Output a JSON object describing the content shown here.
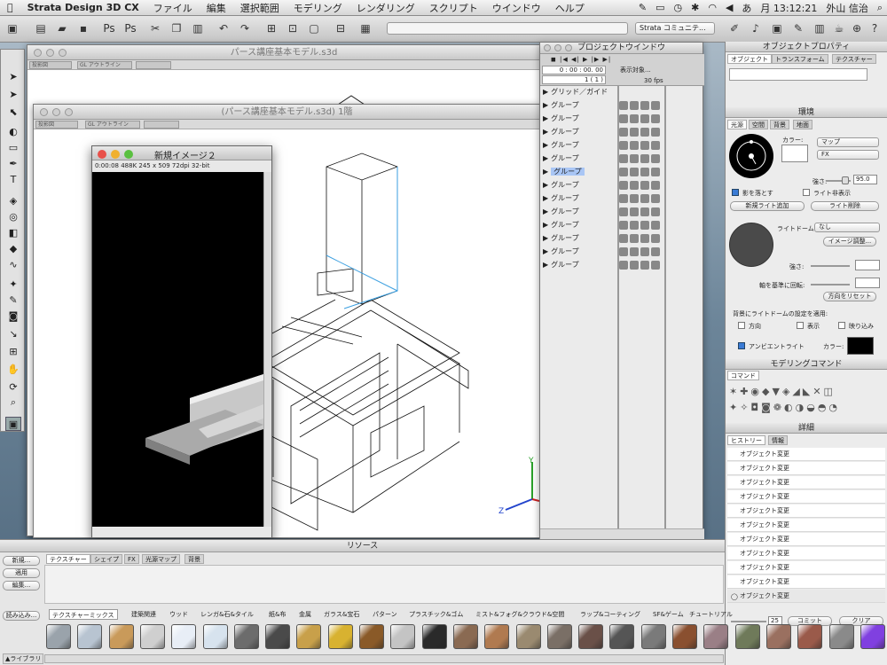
{
  "menubar": {
    "app": "Strata Design 3D CX",
    "items": [
      "ファイル",
      "編集",
      "選択範囲",
      "モデリング",
      "レンダリング",
      "スクリプト",
      "ウインドウ",
      "ヘルプ"
    ],
    "clock": "月 13:12:21",
    "user": "外山 信治"
  },
  "toolbar": {
    "community": "Strata コミュニテ..."
  },
  "windows": {
    "back_title": "パース講座基本モデル.s3d",
    "front_title": "(パース講座基本モデル.s3d) 1階",
    "back_chip": "GL アウトライン",
    "front_chip": "GL アウトライン",
    "chip_a": "投影図",
    "chip_b": "投影図"
  },
  "image_window": {
    "title": "新規イメージ２",
    "info": "0:00:08  488K  245 x 509  72dpi  32-bit"
  },
  "project": {
    "title": "プロジェクトウインドウ",
    "time": "0 : 00 : 00. 00",
    "frame": "1 ( 1 )",
    "display": "表示対象...",
    "fps": "30 fps",
    "rows": [
      "グリッド／ガイド",
      "グループ",
      "グループ",
      "グループ",
      "グループ",
      "グループ",
      "グループ",
      "グループ",
      "グループ",
      "グループ",
      "グループ",
      "グループ",
      "グループ",
      "グループ"
    ]
  },
  "obj_props": {
    "title": "オブジェクトプロパティ",
    "tabs": [
      "オブジェクト",
      "トランスフォーム",
      "テクスチャー"
    ]
  },
  "env": {
    "title": "環境",
    "tabs": [
      "光源",
      "空間",
      "背景",
      "地面"
    ],
    "color_label": "カラー:",
    "map": "マップ",
    "fx": "FX",
    "strength_label": "強さ:",
    "strength_value": "95.0",
    "shadow": "影を落とす",
    "light_hide": "ライト非表示",
    "add_light": "新規ライト追加",
    "delete_light": "ライト削除",
    "dome_label": "ライトドーム:",
    "dome_value": "なし",
    "image_adjust": "イメージ調整...",
    "strength2": "強さ:",
    "rotate_axis": "軸を基準に回転:",
    "reset_dir": "方向をリセット",
    "apply_label": "背景にライトドームの設定を適用:",
    "opt_dir": "方向",
    "opt_show": "表示",
    "opt_reflect": "映り込み",
    "ambient": "アンビエントライト",
    "ambient_color": "カラー:"
  },
  "modeling": {
    "title": "モデリングコマンド",
    "tab": "コマンド"
  },
  "details": {
    "title": "詳細",
    "tabs": [
      "ヒストリー",
      "情報"
    ],
    "history": [
      "オブジェクト変更",
      "オブジェクト変更",
      "オブジェクト変更",
      "オブジェクト変更",
      "オブジェクト変更",
      "オブジェクト変更",
      "オブジェクト変更",
      "オブジェクト変更",
      "オブジェクト変更",
      "オブジェクト変更",
      "オブジェクト変更"
    ],
    "count": "25",
    "commit": "コミット",
    "clear": "クリア"
  },
  "resources": {
    "title": "リソース",
    "tabs": [
      "テクスチャー",
      "シェイプ",
      "FX",
      "光源マップ",
      "背景"
    ],
    "btn_new": "新規...",
    "btn_apply": "適用",
    "btn_edit": "編集...",
    "btn_load": "読み込み...",
    "library": "ライブラリ",
    "lib_tabs": [
      "テクスチャーミックス",
      "建築関連",
      "ウッド",
      "レンガ&石&タイル",
      "紙&布",
      "金属",
      "ガラス&宝石",
      "パターン",
      "プラスチック&ゴム",
      "ミスト&フォグ&クラウド&空間",
      "ラップ&コーティング",
      "SF&ゲーム",
      "チュートリアル"
    ]
  },
  "swatches": [
    "#9aa3ab",
    "#b8c4d1",
    "#c99a5a",
    "#cfcfcf",
    "#e8eef6",
    "#d7e3ee",
    "#6c6c6c",
    "#4a4a4a",
    "#c8a04a",
    "#d8b230",
    "#8a5a28",
    "#c4c4c4",
    "#2a2a2a",
    "#8a6a52",
    "#b07a50",
    "#9a8a70",
    "#7a6f66",
    "#6a5048",
    "#555555",
    "#7a7a7a",
    "#8a5030",
    "#9a7f86",
    "#6f7a5a",
    "#9a7060",
    "#9a5a4a",
    "#8a8a8a",
    "#8040e0"
  ]
}
